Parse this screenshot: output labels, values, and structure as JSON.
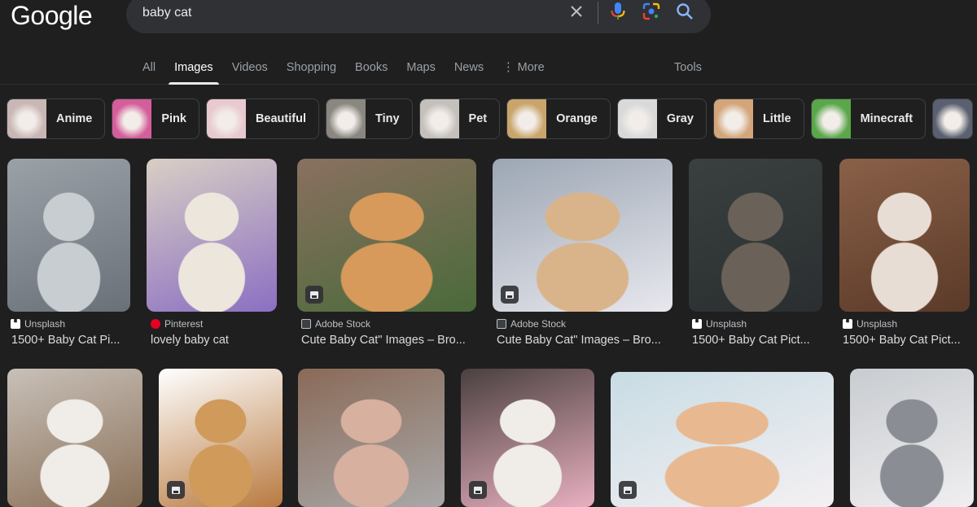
{
  "logo": "Google",
  "search": {
    "query": "baby cat",
    "clear_icon": "close-icon",
    "voice_icon": "microphone-icon",
    "lens_icon": "camera-lens-icon",
    "search_icon": "search-icon"
  },
  "nav": {
    "tabs": [
      {
        "label": "All",
        "active": false
      },
      {
        "label": "Images",
        "active": true
      },
      {
        "label": "Videos",
        "active": false
      },
      {
        "label": "Shopping",
        "active": false
      },
      {
        "label": "Books",
        "active": false
      },
      {
        "label": "Maps",
        "active": false
      },
      {
        "label": "News",
        "active": false
      },
      {
        "label": "⋮ More",
        "active": false
      }
    ],
    "tools": "Tools"
  },
  "chips": [
    {
      "label": "Anime",
      "thumb": "#c9b7b5"
    },
    {
      "label": "Pink",
      "thumb": "#d45e9a"
    },
    {
      "label": "Beautiful",
      "thumb": "#e8c9cf"
    },
    {
      "label": "Tiny",
      "thumb": "#8a8680"
    },
    {
      "label": "Pet",
      "thumb": "#c4c0bb"
    },
    {
      "label": "Orange",
      "thumb": "#c9a56c"
    },
    {
      "label": "Gray",
      "thumb": "#d9d9da"
    },
    {
      "label": "Little",
      "thumb": "#d3a57b"
    },
    {
      "label": "Minecraft",
      "thumb": "#5aa64a"
    },
    {
      "label": "",
      "thumb": "#5a6070"
    }
  ],
  "results": [
    {
      "source": "Unsplash",
      "source_icon": "unsplash-icon",
      "title": "1500+ Baby Cat Pi...",
      "has_badge": false,
      "colors": [
        "#9aa2a8",
        "#c8cdd2",
        "#6a7078"
      ]
    },
    {
      "source": "Pinterest",
      "source_icon": "pinterest-icon",
      "title": "lovely baby cat",
      "has_badge": false,
      "colors": [
        "#d9cfc4",
        "#ece6dd",
        "#8b6fc2"
      ]
    },
    {
      "source": "Adobe Stock",
      "source_icon": "adobe-stock-icon",
      "title": "Cute Baby Cat\" Images – Bro...",
      "has_badge": true,
      "colors": [
        "#8a7060",
        "#d89a5a",
        "#4a6a3a"
      ]
    },
    {
      "source": "Adobe Stock",
      "source_icon": "adobe-stock-icon",
      "title": "Cute Baby Cat\" Images – Bro...",
      "has_badge": true,
      "colors": [
        "#9ca6b4",
        "#d9b48a",
        "#e8e8ee"
      ]
    },
    {
      "source": "Unsplash",
      "source_icon": "unsplash-icon",
      "title": "1500+ Baby Cat Pict...",
      "has_badge": false,
      "colors": [
        "#3a4040",
        "#6a6258",
        "#2a2e30"
      ]
    },
    {
      "source": "Unsplash",
      "source_icon": "unsplash-icon",
      "title": "1500+ Baby Cat Pict...",
      "has_badge": false,
      "colors": [
        "#8a6048",
        "#e8ddd4",
        "#5a3a28"
      ]
    },
    {
      "source": "",
      "title": "",
      "has_badge": false,
      "colors": [
        "#c8c0b8",
        "#f0ece8",
        "#8a7058"
      ]
    },
    {
      "source": "",
      "title": "",
      "has_badge": true,
      "colors": [
        "#ffffff",
        "#d09a5a",
        "#b87a40"
      ]
    },
    {
      "source": "",
      "title": "",
      "has_badge": false,
      "colors": [
        "#8a6a58",
        "#d8b0a0",
        "#a8a8a8"
      ]
    },
    {
      "source": "",
      "title": "",
      "has_badge": true,
      "colors": [
        "#4a4040",
        "#f0ece8",
        "#e8b0c0"
      ]
    },
    {
      "source": "",
      "title": "",
      "has_badge": true,
      "colors": [
        "#c8dce4",
        "#e8b890",
        "#f4f0f2"
      ]
    },
    {
      "source": "",
      "title": "",
      "has_badge": false,
      "colors": [
        "#c8ccd0",
        "#8a8e94",
        "#f0eef0"
      ]
    }
  ]
}
